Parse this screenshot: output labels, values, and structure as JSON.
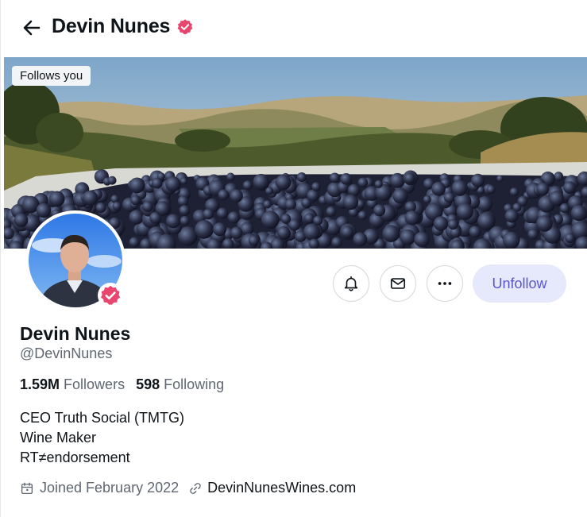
{
  "header": {
    "title": "Devin Nunes"
  },
  "banner": {
    "follows_you": "Follows you"
  },
  "actions": {
    "unfollow_label": "Unfollow"
  },
  "profile": {
    "name": "Devin Nunes",
    "handle": "@DevinNunes",
    "followers_count": "1.59M",
    "followers_label": "Followers",
    "following_count": "598",
    "following_label": "Following",
    "bio_lines": [
      "CEO Truth Social (TMTG)",
      "Wine Maker",
      "RT≠endorsement"
    ],
    "joined": "Joined February 2022",
    "website": "DevinNunesWines.com"
  },
  "colors": {
    "verified_badge": "#e8466f",
    "unfollow_bg": "#e6e8fb",
    "unfollow_text": "#5a55c9"
  },
  "icons": [
    "back-arrow-icon",
    "verified-badge-icon",
    "bell-icon",
    "mail-icon",
    "more-icon",
    "calendar-icon",
    "link-icon"
  ]
}
